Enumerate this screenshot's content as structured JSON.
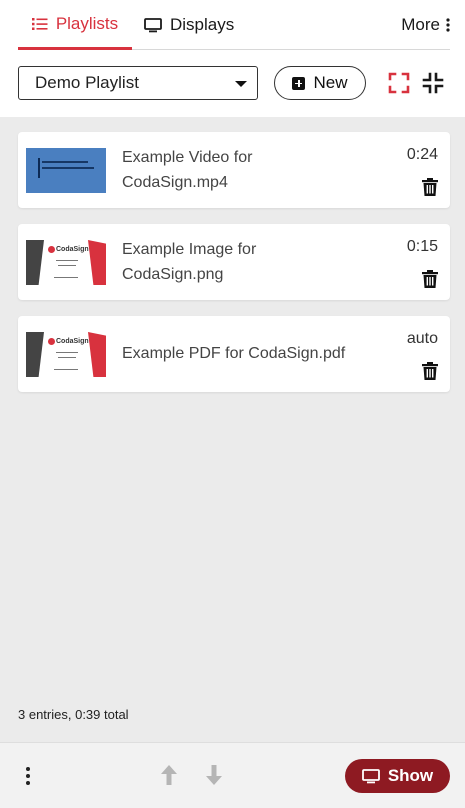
{
  "tabs": {
    "playlists": "Playlists",
    "displays": "Displays",
    "more": "More"
  },
  "toolbar": {
    "playlist_selected": "Demo Playlist",
    "new_label": "New"
  },
  "entries": [
    {
      "name_line1": "Example Video for",
      "name_line2": "CodaSign.mp4",
      "duration": "0:24",
      "thumb": "video"
    },
    {
      "name_line1": "Example Image for",
      "name_line2": "CodaSign.png",
      "duration": "0:15",
      "thumb": "image"
    },
    {
      "name_line1": "Example PDF for CodaSign.pdf",
      "duration": "auto",
      "thumb": "pdf"
    }
  ],
  "thumb_logo_text": "CodaSign",
  "summary": "3 entries, 0:39 total",
  "footer": {
    "show_label": "Show"
  },
  "colors": {
    "accent": "#d8323e",
    "show_button": "#8e1a22",
    "list_background": "#ebebeb",
    "video_thumb": "#4a7fc0"
  },
  "icons": {
    "playlists_tab": "list-icon",
    "displays_tab": "monitor-icon",
    "more_tab": "vertical-dots-icon",
    "new": "plus-square-icon",
    "expand": "expand-icon",
    "compress": "compress-icon",
    "delete": "trash-icon",
    "menu": "vertical-dots-icon",
    "move_up": "arrow-up-icon",
    "move_down": "arrow-down-icon",
    "show": "monitor-icon"
  }
}
